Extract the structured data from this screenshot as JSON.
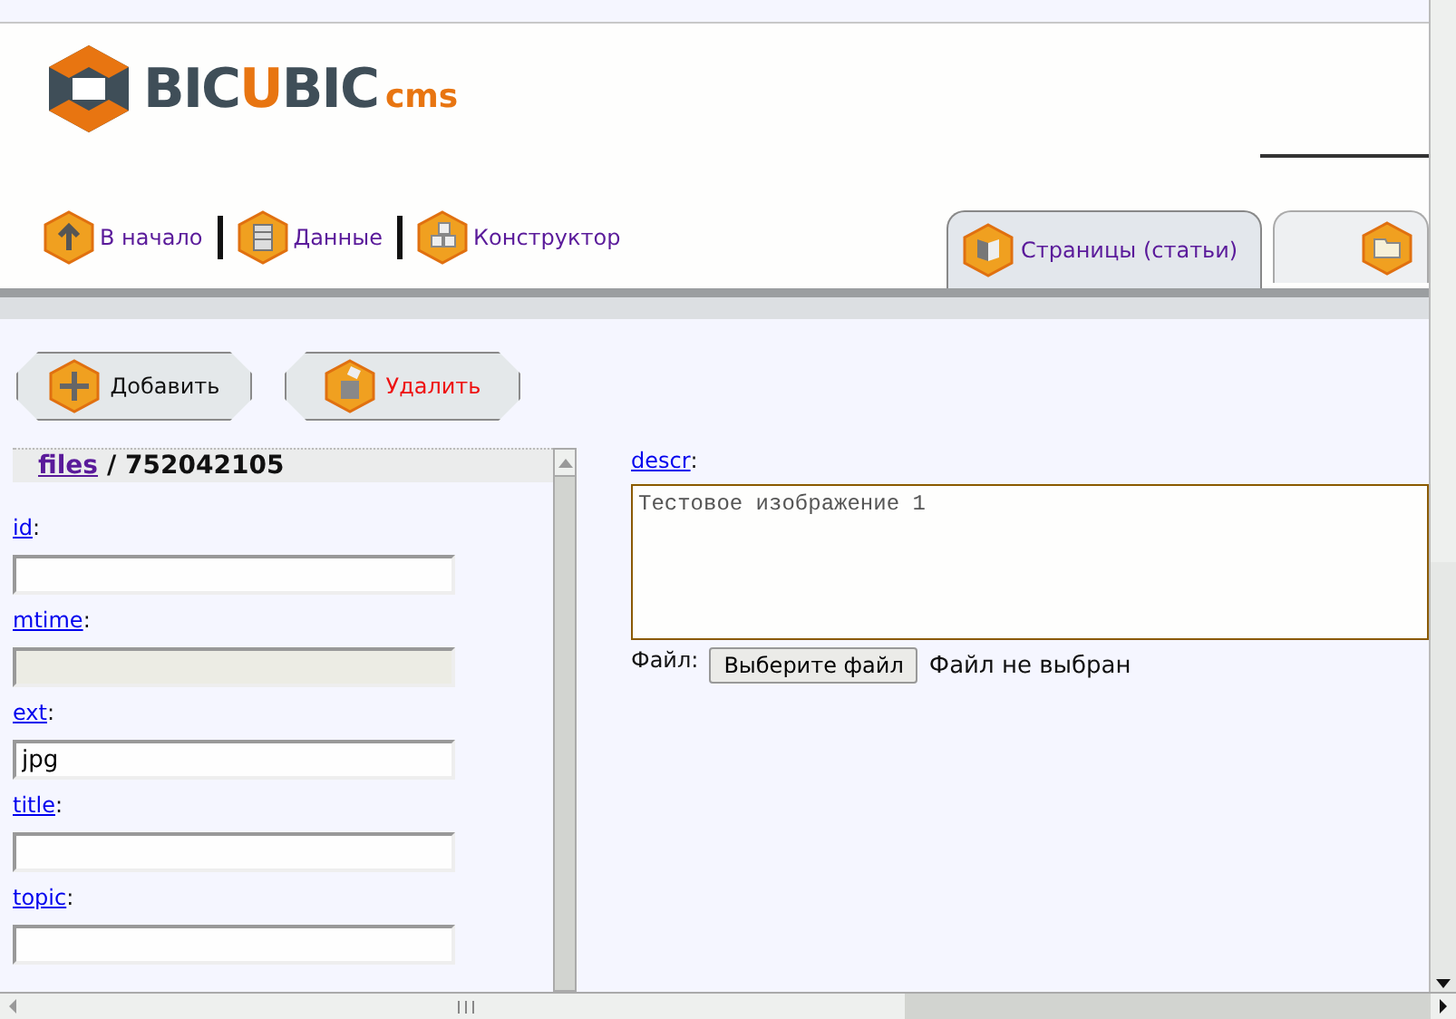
{
  "logo": {
    "main": "BIC",
    "accent": "U",
    "end": "BIC",
    "suffix": "cms"
  },
  "nav": [
    {
      "label": "В начало"
    },
    {
      "label": "Данные"
    },
    {
      "label": "Конструктор"
    }
  ],
  "tabs": [
    {
      "label": "Страницы (статьи)",
      "selected": true
    },
    {
      "selected": false
    }
  ],
  "actions": [
    {
      "label": "Добавить",
      "kind": "add"
    },
    {
      "label": "Удалить",
      "kind": "delete"
    }
  ],
  "record": {
    "table": "files",
    "separator": "/",
    "id": "752042105"
  },
  "fields": [
    {
      "name": "id",
      "colon": ":",
      "disabled": false
    },
    {
      "name": "mtime",
      "colon": ":",
      "disabled": true
    },
    {
      "name": "ext",
      "colon": ":",
      "value": "jpg",
      "disabled": false
    },
    {
      "name": "title",
      "colon": ":",
      "disabled": false
    },
    {
      "name": "topic",
      "colon": ":",
      "disabled": false
    }
  ],
  "descr": {
    "name": "descr",
    "colon": ":",
    "value": "Тестовое изображение 1"
  },
  "file": {
    "label": "Файл:",
    "button": "Выберите файл",
    "status": "Файл не выбран"
  }
}
